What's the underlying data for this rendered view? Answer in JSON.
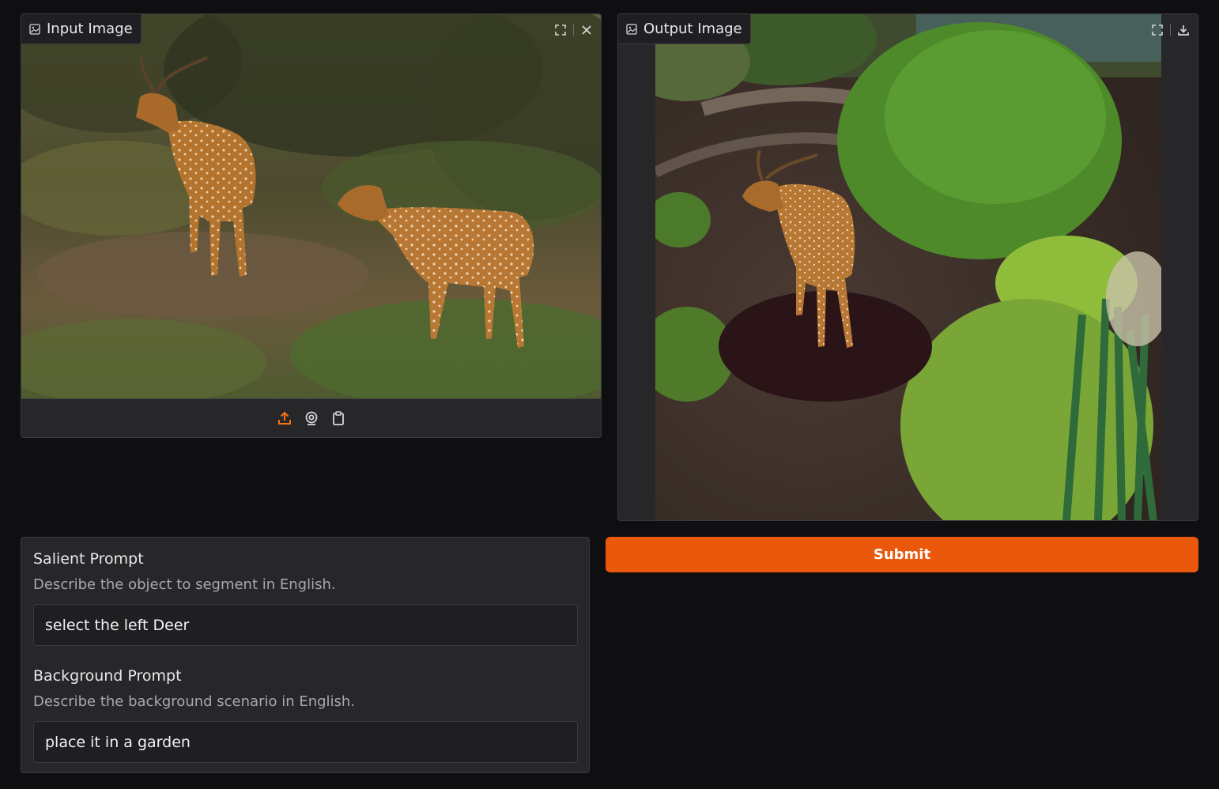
{
  "input_image": {
    "label": "Input Image",
    "label_icon": "image-icon",
    "tools": [
      "fullscreen-icon",
      "close-icon"
    ],
    "sources": [
      "upload-icon",
      "webcam-icon",
      "clipboard-icon"
    ],
    "active_source_color": "#f97316"
  },
  "output_image": {
    "label": "Output Image",
    "label_icon": "image-icon",
    "tools": [
      "fullscreen-icon",
      "download-icon"
    ]
  },
  "salient_prompt": {
    "title": "Salient Prompt",
    "info": "Describe the object to segment in English.",
    "value": "select the left Deer"
  },
  "background_prompt": {
    "title": "Background Prompt",
    "info": "Describe the background scenario in English.",
    "value": "place it in a garden"
  },
  "submit": {
    "label": "Submit",
    "color": "#ea580c"
  }
}
